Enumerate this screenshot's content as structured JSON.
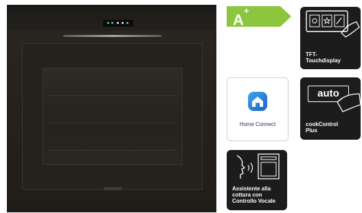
{
  "product": {
    "image_name": "built-in oven"
  },
  "energy_label": {
    "class": "A",
    "suffix": "+",
    "color": "#8cc63f"
  },
  "features": {
    "tft_touch": {
      "label": "TFT-\nTouchdisplay",
      "icon": "touch-display-icon"
    },
    "auto_cook": {
      "badge": "auto",
      "label": "cookControl\nPlus",
      "icon": "hand-touch-icon"
    },
    "home_connect": {
      "label": "Home Connect",
      "icon": "home-connect-icon",
      "color": "#2b7fd6"
    },
    "voice": {
      "label": "Assistente alla\ncottura con\nControllo Vocale",
      "icon": "voice-control-icon"
    }
  }
}
